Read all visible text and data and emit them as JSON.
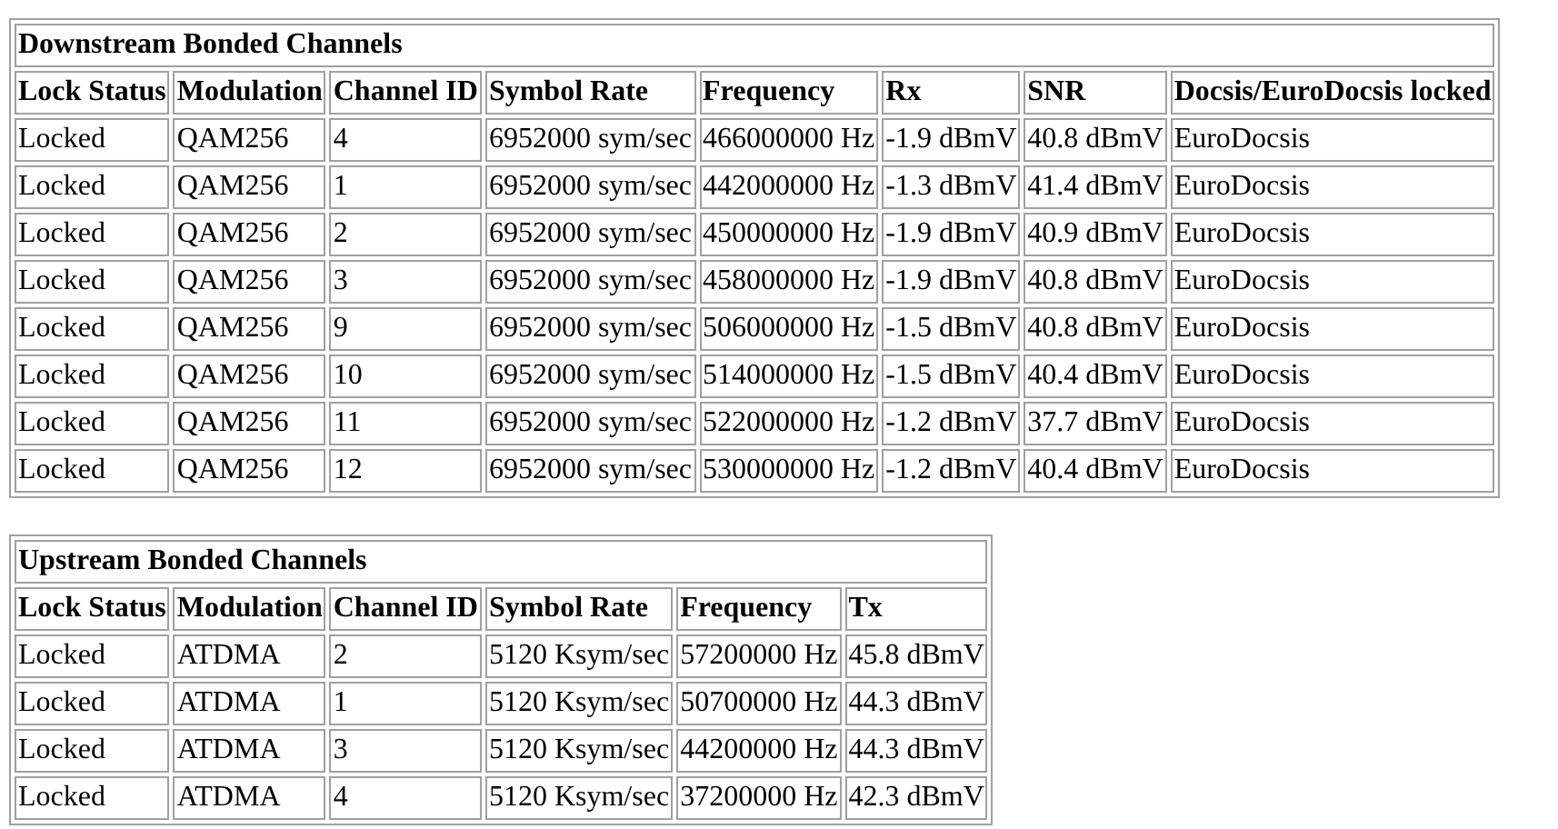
{
  "tables": [
    {
      "title": "Downstream Bonded Channels",
      "columns": [
        "Lock Status",
        "Modulation",
        "Channel ID",
        "Symbol Rate",
        "Frequency",
        "Rx",
        "SNR",
        "Docsis/EuroDocsis locked"
      ],
      "rows": [
        [
          "Locked",
          "QAM256",
          "4",
          "6952000 sym/sec",
          "466000000 Hz",
          "-1.9 dBmV",
          "40.8 dBmV",
          "EuroDocsis"
        ],
        [
          "Locked",
          "QAM256",
          "1",
          "6952000 sym/sec",
          "442000000 Hz",
          "-1.3 dBmV",
          "41.4 dBmV",
          "EuroDocsis"
        ],
        [
          "Locked",
          "QAM256",
          "2",
          "6952000 sym/sec",
          "450000000 Hz",
          "-1.9 dBmV",
          "40.9 dBmV",
          "EuroDocsis"
        ],
        [
          "Locked",
          "QAM256",
          "3",
          "6952000 sym/sec",
          "458000000 Hz",
          "-1.9 dBmV",
          "40.8 dBmV",
          "EuroDocsis"
        ],
        [
          "Locked",
          "QAM256",
          "9",
          "6952000 sym/sec",
          "506000000 Hz",
          "-1.5 dBmV",
          "40.8 dBmV",
          "EuroDocsis"
        ],
        [
          "Locked",
          "QAM256",
          "10",
          "6952000 sym/sec",
          "514000000 Hz",
          "-1.5 dBmV",
          "40.4 dBmV",
          "EuroDocsis"
        ],
        [
          "Locked",
          "QAM256",
          "11",
          "6952000 sym/sec",
          "522000000 Hz",
          "-1.2 dBmV",
          "37.7 dBmV",
          "EuroDocsis"
        ],
        [
          "Locked",
          "QAM256",
          "12",
          "6952000 sym/sec",
          "530000000 Hz",
          "-1.2 dBmV",
          "40.4 dBmV",
          "EuroDocsis"
        ]
      ]
    },
    {
      "title": "Upstream Bonded Channels",
      "columns": [
        "Lock Status",
        "Modulation",
        "Channel ID",
        "Symbol Rate",
        "Frequency",
        "Tx"
      ],
      "rows": [
        [
          "Locked",
          "ATDMA",
          "2",
          "5120 Ksym/sec",
          "57200000 Hz",
          "45.8 dBmV"
        ],
        [
          "Locked",
          "ATDMA",
          "1",
          "5120 Ksym/sec",
          "50700000 Hz",
          "44.3 dBmV"
        ],
        [
          "Locked",
          "ATDMA",
          "3",
          "5120 Ksym/sec",
          "44200000 Hz",
          "44.3 dBmV"
        ],
        [
          "Locked",
          "ATDMA",
          "4",
          "5120 Ksym/sec",
          "37200000 Hz",
          "42.3 dBmV"
        ]
      ]
    }
  ]
}
